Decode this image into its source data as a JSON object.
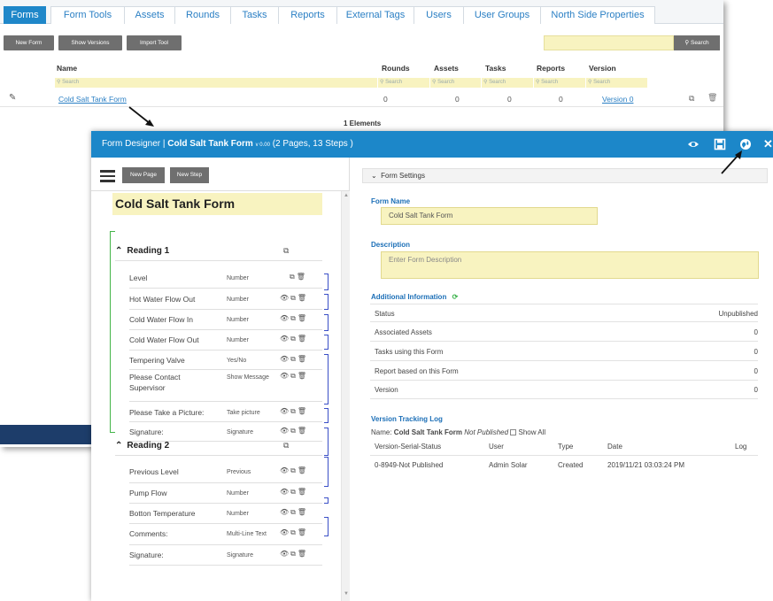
{
  "bg": {
    "tabs": [
      "Forms",
      "Form Tools",
      "Assets",
      "Rounds",
      "Tasks",
      "Reports",
      "External Tags",
      "Users",
      "User Groups",
      "North Side Properties"
    ],
    "buttons": {
      "new_form": "New Form",
      "show_versions": "Show Versions",
      "import_tool": "Import Tool"
    },
    "search_button": "Search",
    "columns": {
      "name": "Name",
      "rounds": "Rounds",
      "assets": "Assets",
      "tasks": "Tasks",
      "reports": "Reports",
      "version": "Version"
    },
    "filter_placeholder": "Search",
    "row": {
      "name": "Cold Salt Tank Form",
      "rounds": "0",
      "assets": "0",
      "tasks": "0",
      "reports": "0",
      "version": "Version 0"
    },
    "elements_count": "1 Elements"
  },
  "modal": {
    "header_prefix": "Form Designer | ",
    "form_name": "Cold Salt Tank Form",
    "version_small": "v 0.00",
    "header_suffix": " (2 Pages, 13 Steps )",
    "new_page": "New Page",
    "new_step": "New Step",
    "form_title": "Cold Salt Tank Form",
    "sections": [
      {
        "title": "Reading 1",
        "steps": [
          {
            "label": "Level",
            "type": "Number"
          },
          {
            "label": "Hot Water Flow Out",
            "type": "Number"
          },
          {
            "label": "Cold Water Flow In",
            "type": "Number"
          },
          {
            "label": "Cold Water Flow Out",
            "type": "Number"
          },
          {
            "label": "Tempering Valve",
            "type": "Yes/No"
          },
          {
            "label": "Please Contact Supervisor",
            "type": "Show Message"
          },
          {
            "label": "Please Take a Picture:",
            "type": "Take picture"
          },
          {
            "label": "Signature:",
            "type": "Signature"
          }
        ]
      },
      {
        "title": "Reading 2",
        "steps": [
          {
            "label": "Previous Level",
            "type": "Previous"
          },
          {
            "label": "Pump Flow",
            "type": "Number"
          },
          {
            "label": "Botton Temperature",
            "type": "Number"
          },
          {
            "label": "Comments:",
            "type": "Multi-Line Text"
          },
          {
            "label": "Signature:",
            "type": "Signature"
          }
        ]
      }
    ],
    "settings": {
      "section_title": "Form Settings",
      "form_name_label": "Form Name",
      "form_name_value": "Cold Salt Tank Form",
      "description_label": "Description",
      "description_placeholder": "Enter Form Description",
      "additional_label": "Additional Information",
      "info": [
        {
          "label": "Status",
          "value": "Unpublished"
        },
        {
          "label": "Associated Assets",
          "value": "0"
        },
        {
          "label": "Tasks using this Form",
          "value": "0"
        },
        {
          "label": "Report based on this Form",
          "value": "0"
        },
        {
          "label": "Version",
          "value": "0"
        }
      ],
      "log_title": "Version Tracking Log",
      "log_name_prefix": "Name: ",
      "log_name": "Cold Salt Tank Form",
      "log_not_published": "Not Published",
      "show_all": "Show All",
      "log_columns": [
        "Version-Serial-Status",
        "User",
        "Type",
        "Date",
        "Log"
      ],
      "log_row": [
        "0-8949-Not Published",
        "Admin Solar",
        "Created",
        "2019/11/21 03:03:24 PM",
        ""
      ]
    }
  }
}
